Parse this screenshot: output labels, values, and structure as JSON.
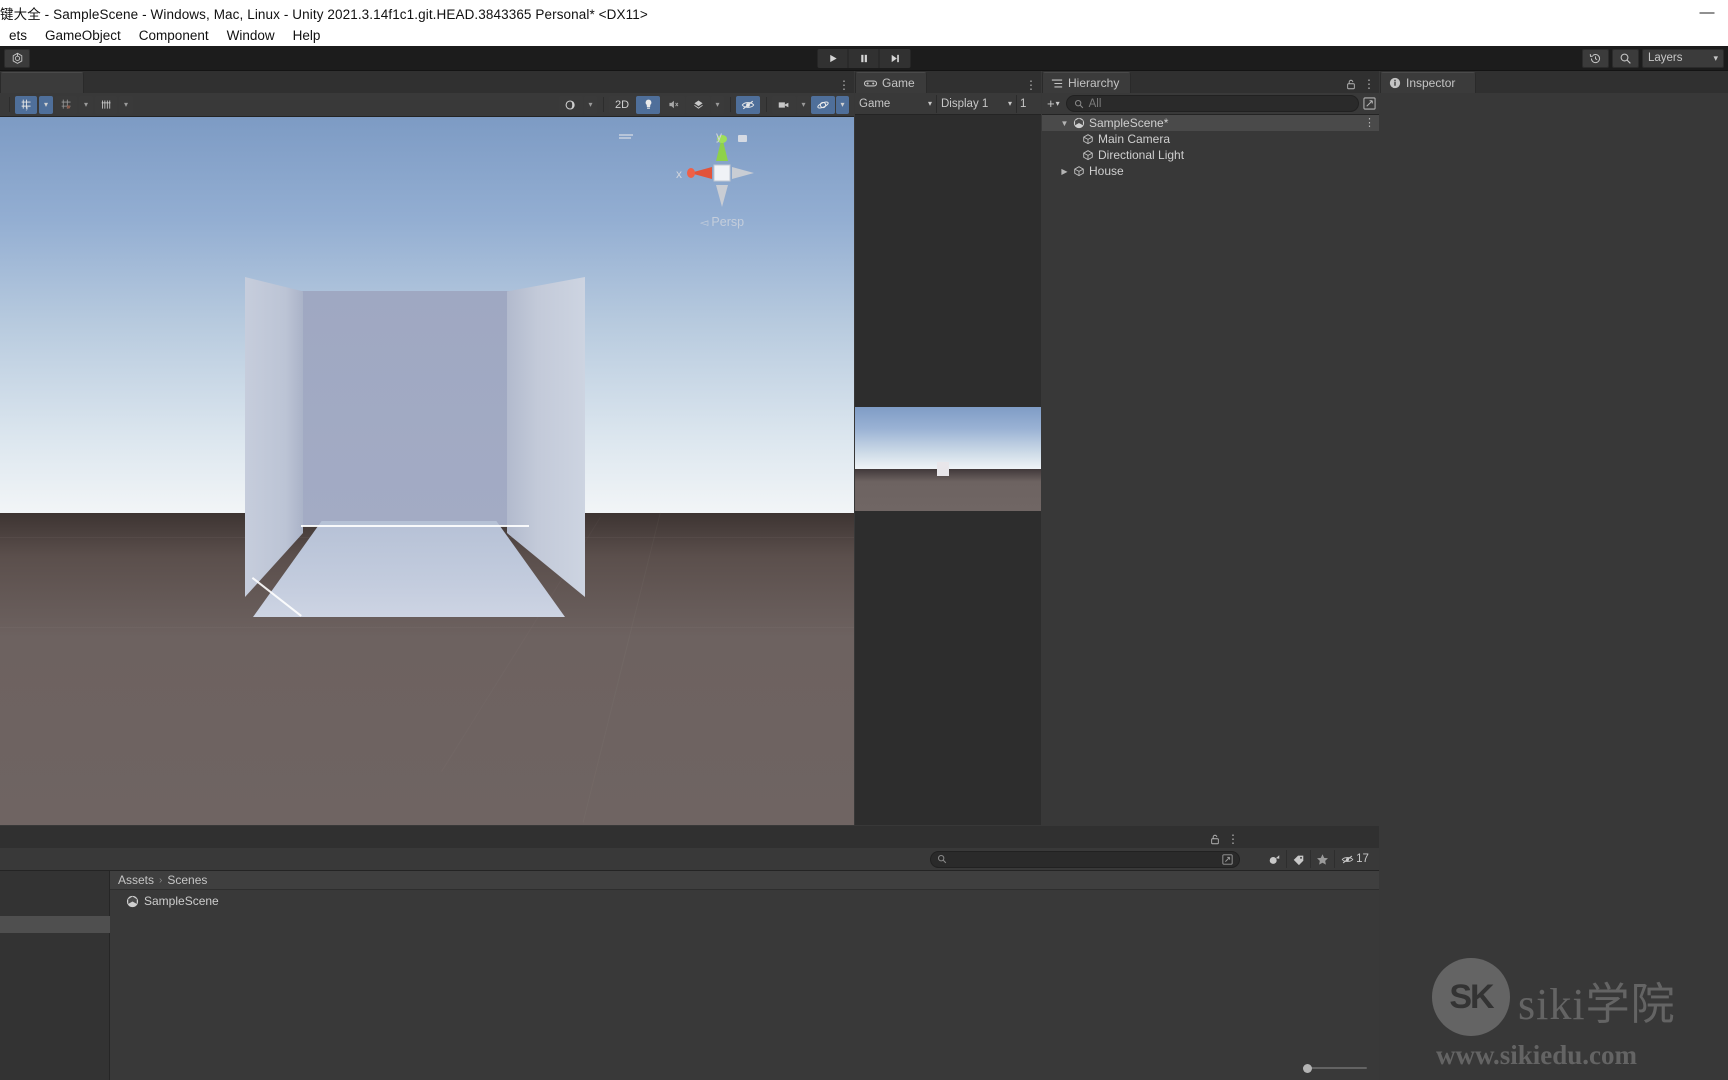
{
  "window": {
    "title": "键大全 - SampleScene - Windows, Mac, Linux - Unity 2021.3.14f1c1.git.HEAD.3843365 Personal* <DX11>",
    "minimize": "—",
    "maximize": "▢",
    "close": "✕"
  },
  "menubar": {
    "items": [
      {
        "label": "ets"
      },
      {
        "label": "GameObject"
      },
      {
        "label": "Component"
      },
      {
        "label": "Window"
      },
      {
        "label": "Help"
      }
    ]
  },
  "toolbar": {
    "account_icon": "unity-cloud-icon",
    "play": "▶",
    "pause": "❚❚",
    "step": "▶❙",
    "undo_history_icon": "history-icon",
    "search_icon": "search-icon",
    "layers_label": "Layers",
    "layers_arrow": "▾"
  },
  "scene": {
    "tab_label": "",
    "tools": {
      "pivot_rotation": "center-pivot-icon",
      "grid_snap": "grid-snap-icon",
      "grid_visibility": "grid-visibility-icon",
      "arrow": "▾"
    },
    "view_options": {
      "shading_mode": "shaded-icon",
      "two_d": "2D",
      "lighting": "light-bulb-icon",
      "audio": "audio-mute-icon",
      "effects": "effects-icon",
      "hidden_objects": "visibility-off-icon",
      "camera": "scene-camera-icon",
      "gizmos": "gizmos-icon"
    },
    "gizmo": {
      "x_label": "x",
      "y_label": "y",
      "projection": "Persp"
    }
  },
  "game": {
    "tab_label": "Game",
    "tab_icon": "game-controller-icon",
    "aspect_label": "Game",
    "display_label": "Display 1",
    "scale_value": "1"
  },
  "hierarchy": {
    "tab_label": "Hierarchy",
    "tab_icon": "hierarchy-icon",
    "add_label": "+",
    "add_arrow": "▾",
    "search_placeholder": "All",
    "lock_icon": "lock-icon",
    "menu_icon": "kebab-menu-icon",
    "items": [
      {
        "label": "SampleScene*",
        "depth": 0,
        "icon": "unity-scene-icon",
        "expanded": true,
        "selected": true,
        "has_children": true
      },
      {
        "label": "Main Camera",
        "depth": 1,
        "icon": "gameobject-icon",
        "expanded": false,
        "selected": false,
        "has_children": false
      },
      {
        "label": "Directional Light",
        "depth": 1,
        "icon": "gameobject-icon",
        "expanded": false,
        "selected": false,
        "has_children": false
      },
      {
        "label": "House",
        "depth": 1,
        "icon": "gameobject-icon",
        "expanded": false,
        "selected": false,
        "has_children": true
      }
    ]
  },
  "inspector": {
    "tab_label": "Inspector",
    "tab_icon": "info-icon"
  },
  "project": {
    "lock_icon": "lock-icon",
    "menu_icon": "kebab-menu-icon",
    "search_placeholder": "",
    "search_icon": "search-icon",
    "filters": [
      {
        "name": "save-search-icon",
        "glyph": "⧉"
      },
      {
        "name": "type-filter-icon",
        "glyph": "◕"
      },
      {
        "name": "label-filter-icon",
        "glyph": "🏷"
      },
      {
        "name": "favorite-filter-icon",
        "glyph": "★"
      }
    ],
    "hidden_count_icon": "visibility-off-icon",
    "hidden_count": "17",
    "breadcrumb": [
      {
        "label": "Assets"
      },
      {
        "label": "Scenes"
      }
    ],
    "breadcrumb_sep": "›",
    "assets": [
      {
        "label": "SampleScene",
        "icon": "unity-scene-icon"
      }
    ],
    "zoom_slider_value": 0
  },
  "watermark": {
    "logo_text": "SK",
    "brand": "siki学院",
    "url": "www.sikiedu.com"
  }
}
